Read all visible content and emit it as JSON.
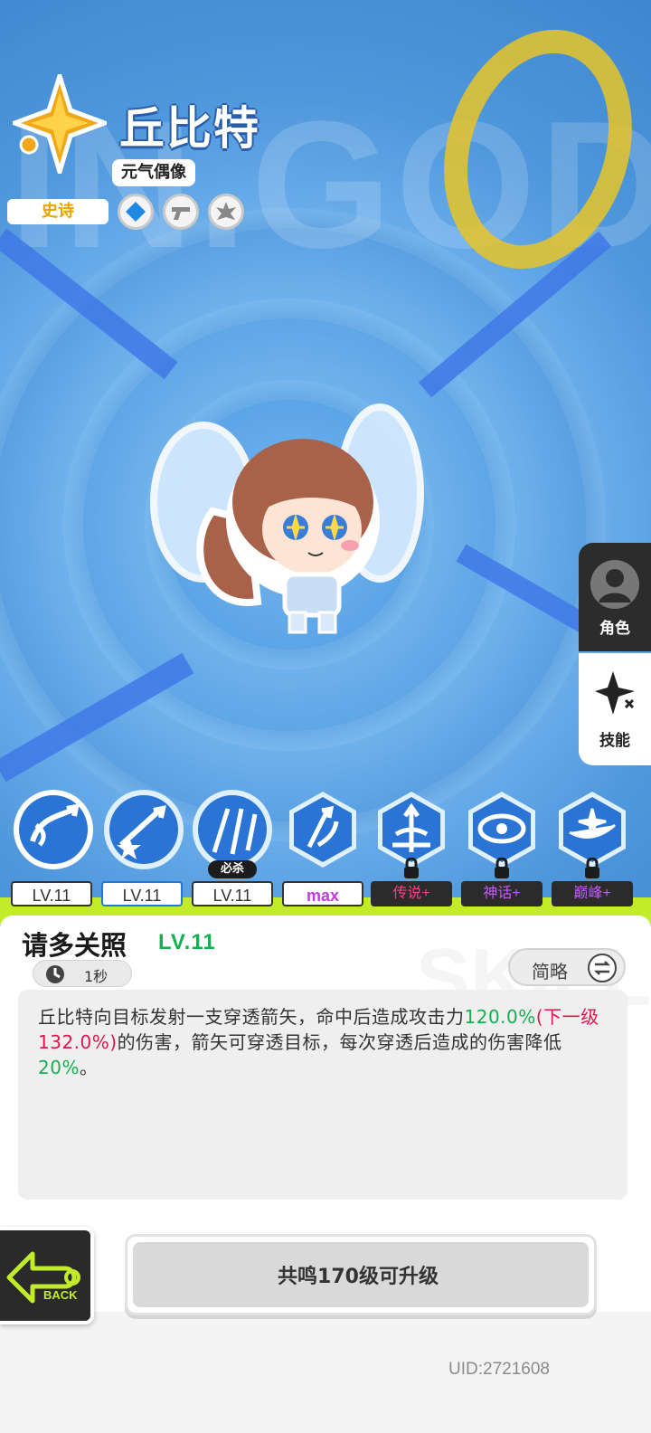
{
  "hero": {
    "name": "丘比特",
    "title": "元气偶像",
    "rarity": "史诗",
    "background_text": "IN.GOD",
    "traits": [
      "cross-trait-icon",
      "gun-trait-icon",
      "burst-trait-icon"
    ]
  },
  "side_tabs": {
    "role_label": "角色",
    "skill_label": "技能"
  },
  "skills": [
    {
      "icon": "bow-swirl-skill-icon",
      "level": "LV.11",
      "selected": true
    },
    {
      "icon": "star-shield-skill-icon",
      "level": "LV.11"
    },
    {
      "icon": "arrow-rain-skill-icon",
      "level": "LV.11",
      "tag": "必杀"
    },
    {
      "icon": "arrow-wave-skill-icon",
      "level": "max"
    },
    {
      "icon": "fountain-skill-icon",
      "level": "传说+",
      "locked": true
    },
    {
      "icon": "vortex-skill-icon",
      "level": "神话+",
      "locked": true
    },
    {
      "icon": "comet-skill-icon",
      "level": "巅峰+",
      "locked": true
    }
  ],
  "detail": {
    "skill_name": "请多关照",
    "skill_level": "LV.11",
    "cooldown": "1秒",
    "toggle_label": "简略",
    "desc_part1": "丘比特向目标发射一支穿透箭矢，命中后造成攻击力",
    "desc_value": "120.0%",
    "desc_next": "(下一级132.0%)",
    "desc_part2": "的伤害，箭矢可穿透目标，每次穿透后造成的伤害降低",
    "desc_reduce": "20%",
    "desc_end": "。"
  },
  "footer": {
    "back_label": "BACK",
    "upgrade_label": "共鸣170级可升级",
    "uid": "UID:2721608"
  },
  "colors": {
    "accent_green": "#14b052",
    "accent_red": "#e0154d",
    "slime": "#c2ec2a",
    "rarity_gold": "#e8a400"
  }
}
